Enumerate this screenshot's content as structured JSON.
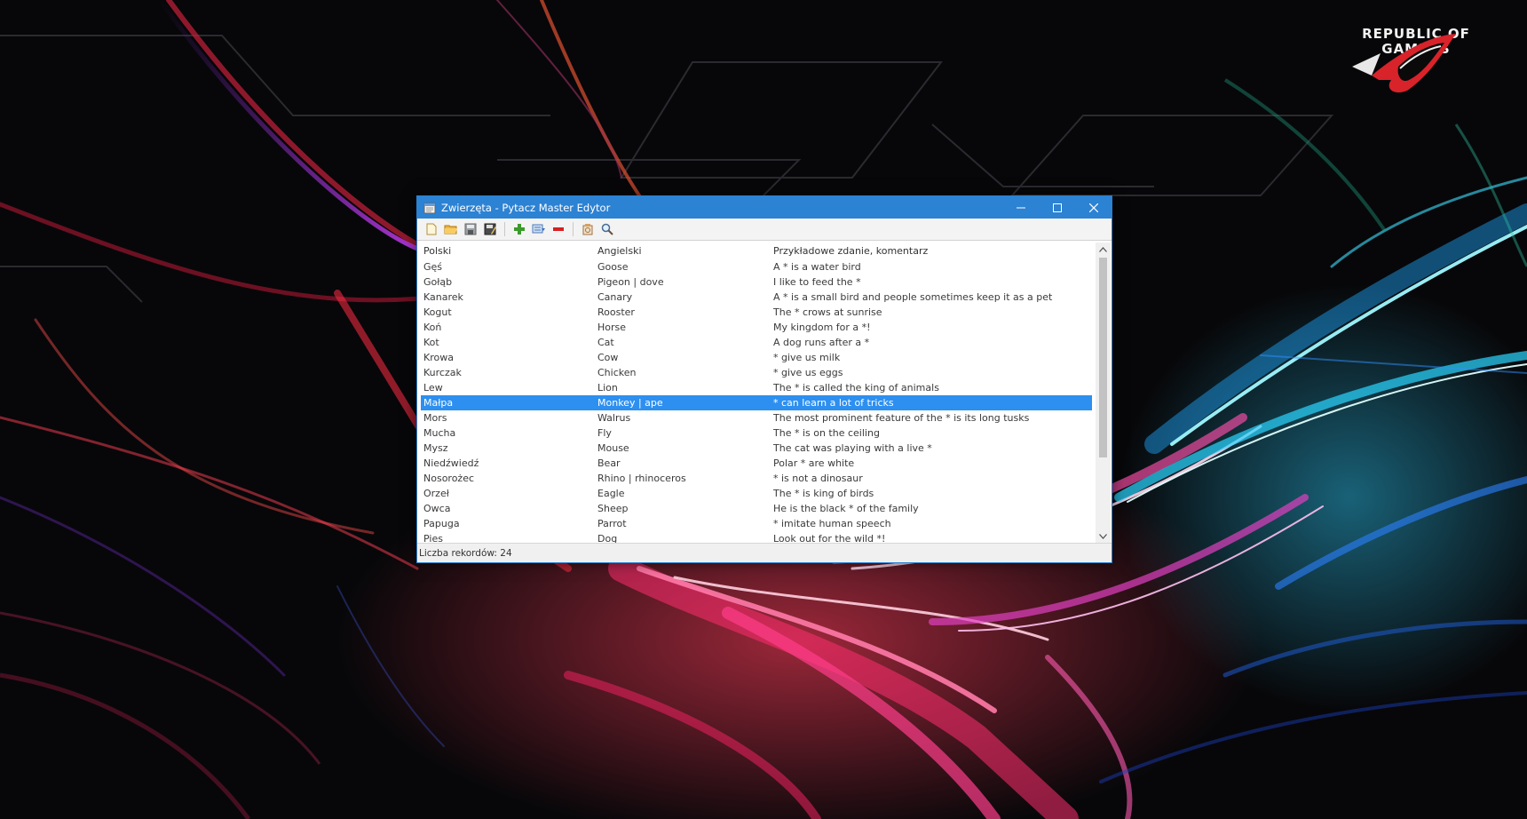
{
  "wallpaper": {
    "brand_line1": "REPUBLIC OF",
    "brand_line2": "GAMERS",
    "logo_icon": "rog-eye-logo"
  },
  "window": {
    "title": "Zwierzęta - Pytacz Master Edytor",
    "title_icon": "notepad-icon",
    "controls": [
      "minimize",
      "maximize",
      "close"
    ],
    "accent_color": "#2c82d3",
    "selection_color": "#2d8ff0"
  },
  "toolbar": {
    "buttons": [
      "new-file-icon",
      "open-folder-icon",
      "save-icon",
      "save-as-icon",
      "add-record-icon",
      "edit-record-icon",
      "delete-record-icon",
      "settings-icon",
      "search-icon"
    ]
  },
  "table": {
    "columns": [
      "Polski",
      "Angielski",
      "Przykładowe zdanie, komentarz"
    ],
    "selected_index": 9,
    "rows": [
      [
        "Gęś",
        "Goose",
        "A * is a water bird"
      ],
      [
        "Gołąb",
        "Pigeon | dove",
        "I like to feed the *"
      ],
      [
        "Kanarek",
        "Canary",
        "A * is a small bird and people sometimes keep it as a pet"
      ],
      [
        "Kogut",
        "Rooster",
        "The * crows at sunrise"
      ],
      [
        "Koń",
        "Horse",
        "My kingdom for a *!"
      ],
      [
        "Kot",
        "Cat",
        "A dog runs after a *"
      ],
      [
        "Krowa",
        "Cow",
        "* give us milk"
      ],
      [
        "Kurczak",
        "Chicken",
        "* give us eggs"
      ],
      [
        "Lew",
        "Lion",
        "The * is called the king of animals"
      ],
      [
        "Małpa",
        "Monkey | ape",
        "* can learn a lot of tricks"
      ],
      [
        "Mors",
        "Walrus",
        "The most prominent feature of the * is its long tusks"
      ],
      [
        "Mucha",
        "Fly",
        "The * is on the ceiling"
      ],
      [
        "Mysz",
        "Mouse",
        "The cat was playing with a live *"
      ],
      [
        "Niedźwiedź",
        "Bear",
        "Polar * are white"
      ],
      [
        "Nosorożec",
        "Rhino | rhinoceros",
        "* is not a dinosaur"
      ],
      [
        "Orzeł",
        "Eagle",
        "The * is king of birds"
      ],
      [
        "Owca",
        "Sheep",
        "He is the black * of the family"
      ],
      [
        "Papuga",
        "Parrot",
        "* imitate human speech"
      ],
      [
        "Pies",
        "Dog",
        "Look out for the wild *!"
      ]
    ]
  },
  "status": {
    "text": "Liczba rekordów: 24"
  }
}
